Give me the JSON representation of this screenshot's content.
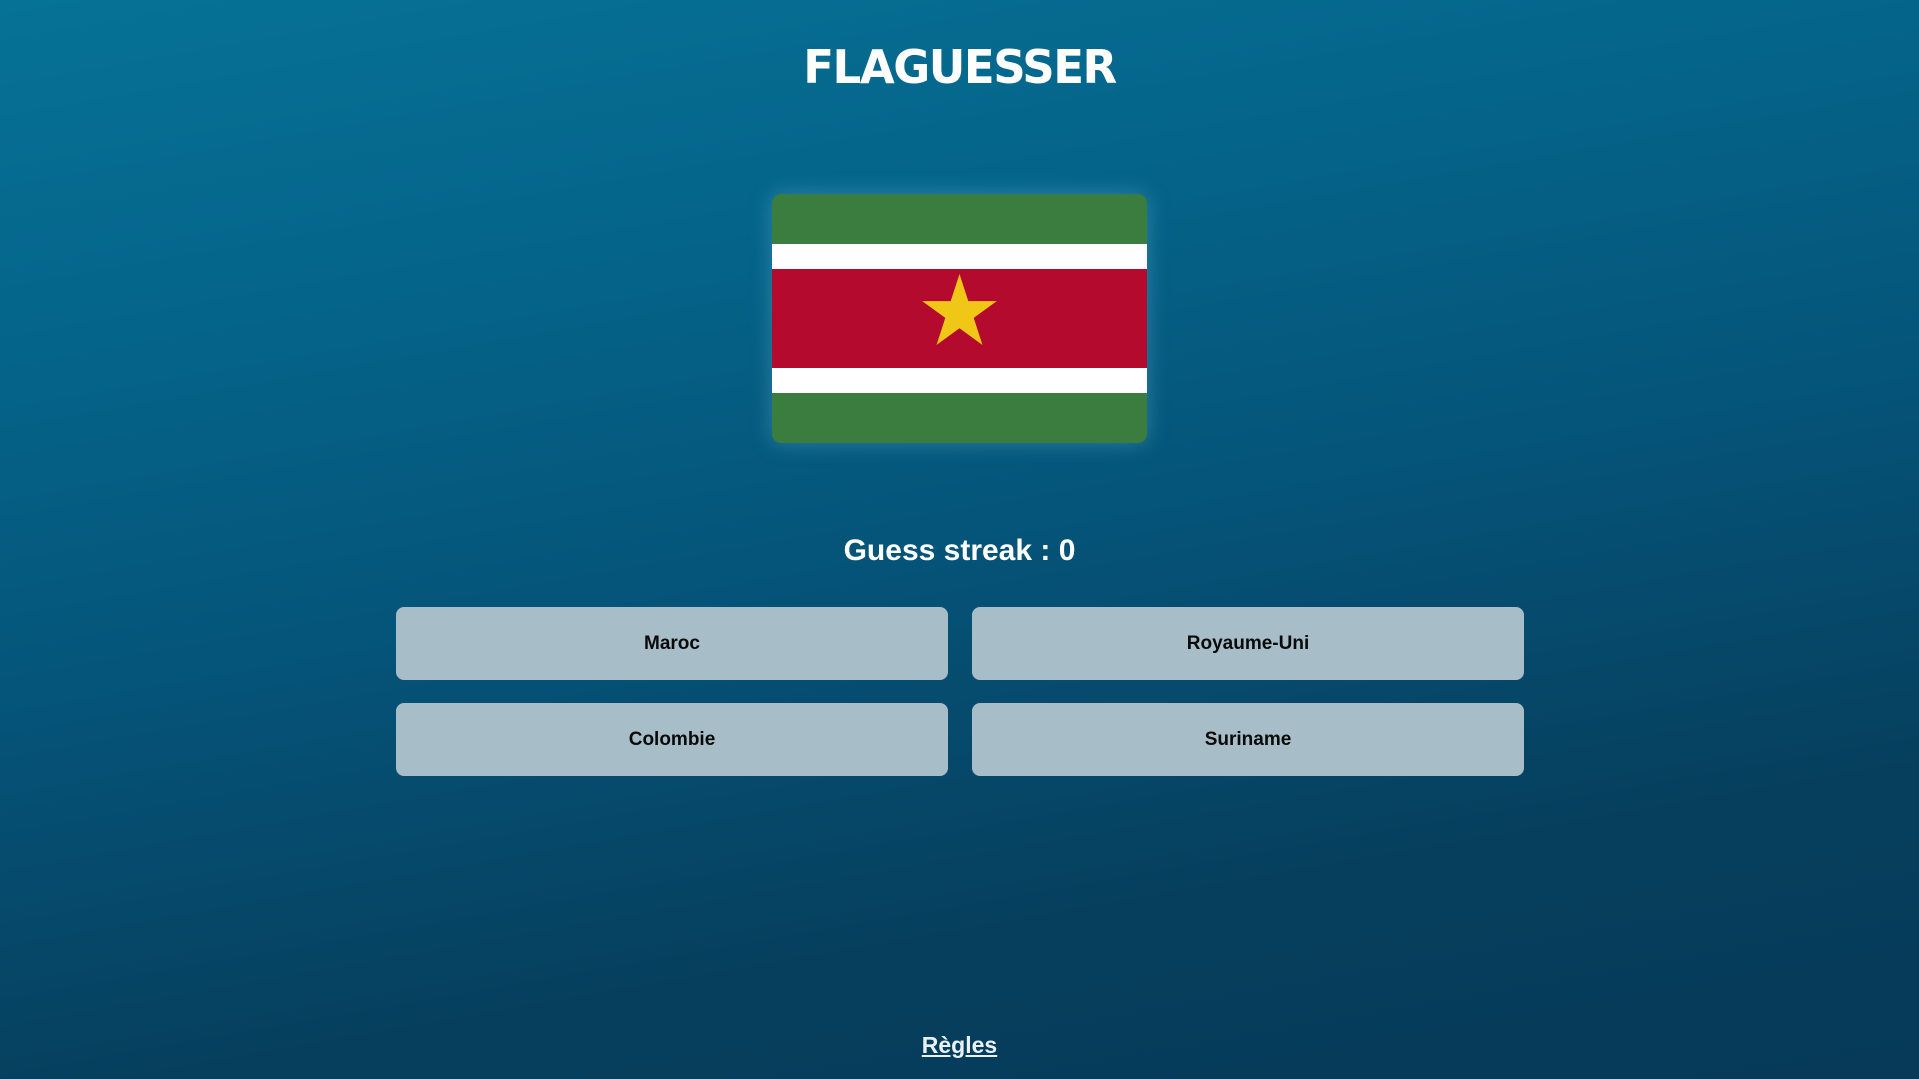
{
  "header": {
    "logo_text": "FLAGUESSER"
  },
  "flag": {
    "icon": "suriname-flag-icon",
    "colors": {
      "green": "#3b7d3e",
      "white": "#ffffff",
      "red": "#b40a2d",
      "star": "#f0c617"
    }
  },
  "game": {
    "streak_text": "Guess streak : 0",
    "choices": [
      {
        "label": "Maroc"
      },
      {
        "label": "Royaume-Uni"
      },
      {
        "label": "Colombie"
      },
      {
        "label": "Suriname"
      }
    ]
  },
  "footer": {
    "rules_link": "Règles"
  }
}
